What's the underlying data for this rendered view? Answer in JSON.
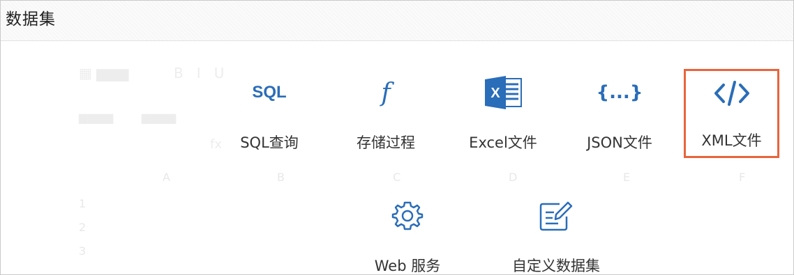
{
  "dialog": {
    "title": "数据集"
  },
  "options": [
    {
      "id": "sql",
      "label": "SQL查询",
      "icon": "sql-icon",
      "glyph": "SQL"
    },
    {
      "id": "procedure",
      "label": "存储过程",
      "icon": "function-icon",
      "glyph": "f"
    },
    {
      "id": "excel",
      "label": "Excel文件",
      "icon": "excel-icon"
    },
    {
      "id": "json",
      "label": "JSON文件",
      "icon": "json-braces-icon",
      "glyph": "{...}"
    },
    {
      "id": "xml",
      "label": "XML文件",
      "icon": "code-tag-icon",
      "selected": true
    },
    {
      "id": "web",
      "label": "Web 服务",
      "icon": "gear-icon"
    },
    {
      "id": "custom",
      "label": "自定义数据集",
      "icon": "edit-document-icon"
    }
  ],
  "colors": {
    "accent_icon": "#2a6db8",
    "selection_border": "#e8643c"
  }
}
